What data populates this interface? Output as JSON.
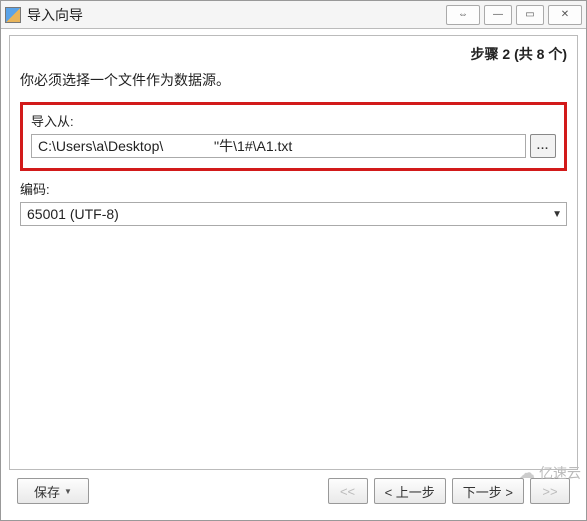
{
  "titlebar": {
    "title": "导入向导",
    "swap_tooltip": "⇔",
    "min": "—",
    "max": "▭",
    "close": "✕"
  },
  "step": {
    "label": "步骤 2 (共 8 个)"
  },
  "instruction": "你必须选择一个文件作为数据源。",
  "import_from": {
    "label": "导入从:",
    "value": "C:\\Users\\a\\Desktop\\             ''牛\\1#\\A1.txt",
    "browse": "..."
  },
  "encoding": {
    "label": "编码:",
    "value": "65001 (UTF-8)"
  },
  "buttons": {
    "save": "保存",
    "first": "<<",
    "prev": "< 上一步",
    "next": "下一步 >",
    "last": ">>"
  },
  "watermark": {
    "text": "亿速云"
  }
}
